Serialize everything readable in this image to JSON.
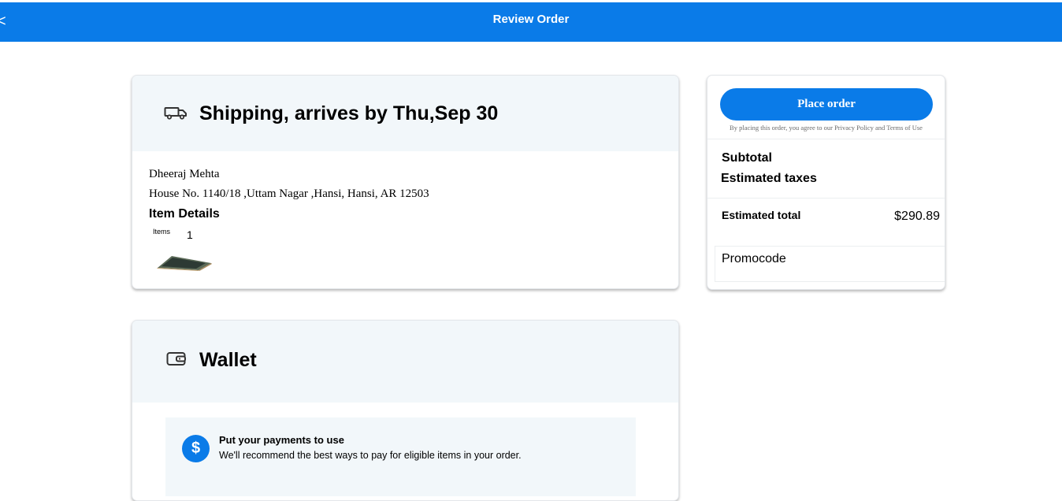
{
  "header": {
    "back_glyph": "<",
    "title": "Review Order"
  },
  "shipping": {
    "title": "Shipping, arrives by Thu,Sep 30",
    "recipient_name": "Dheeraj Mehta",
    "address": "House No. 1140/18 ,Uttam Nagar ,Hansi, Hansi, AR 12503",
    "item_details_heading": "Item Details",
    "items_label": "Items",
    "items_count": "1"
  },
  "summary": {
    "place_order_label": "Place order",
    "disclaimer": "By placing this order, you agree to our Privacy Policy and Terms of Use",
    "subtotal_label": "Subtotal",
    "taxes_label": "Estimated taxes",
    "total_label": "Estimated total",
    "total_value": "$290.89",
    "promocode_label": "Promocode"
  },
  "wallet": {
    "title": "Wallet",
    "tip_icon": "$",
    "tip_title": "Put your payments to use",
    "tip_body": "We'll recommend the best ways to pay for eligible items in your order."
  },
  "colors": {
    "accent": "#0a7be8",
    "card_header": "#f2f7fa"
  },
  "icons": [
    "truck-icon",
    "wallet-icon",
    "dollar-icon",
    "back-arrow-icon"
  ]
}
